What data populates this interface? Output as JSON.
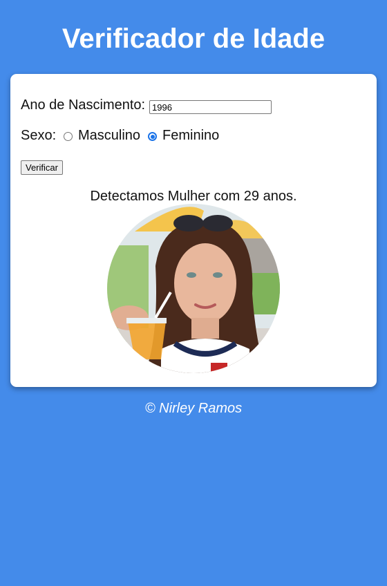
{
  "page": {
    "title": "Verificador de Idade",
    "footer": "© Nirley Ramos",
    "background_color": "#448bea"
  },
  "form": {
    "ano_label": "Ano de Nascimento:",
    "ano_value": "1996",
    "sexo_label": "Sexo:",
    "options": [
      {
        "label": "Masculino",
        "checked": false
      },
      {
        "label": "Feminino",
        "checked": true
      }
    ],
    "submit_label": "Verificar"
  },
  "result": {
    "text": "Detectamos Mulher com 29 anos.",
    "image": "woman-photo"
  }
}
